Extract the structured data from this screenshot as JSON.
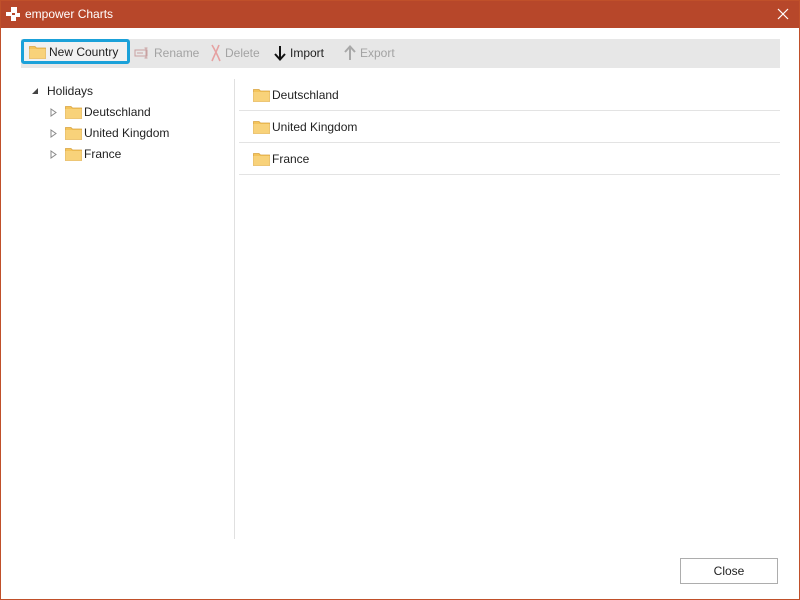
{
  "window": {
    "title": "empower Charts",
    "accent_color": "#b7472a",
    "close_icon": "close-icon"
  },
  "toolbar": {
    "new_country_label": "New Country",
    "rename_label": "Rename",
    "delete_label": "Delete",
    "import_label": "Import",
    "export_label": "Export",
    "selected_item": "New Country",
    "highlight_color": "#1ba1d9"
  },
  "tree": {
    "root_label": "Holidays",
    "children": [
      {
        "label": "Deutschland"
      },
      {
        "label": "United Kingdom"
      },
      {
        "label": "France"
      }
    ]
  },
  "list": {
    "items": [
      {
        "label": "Deutschland"
      },
      {
        "label": "United Kingdom"
      },
      {
        "label": "France"
      }
    ]
  },
  "footer": {
    "close_label": "Close"
  }
}
